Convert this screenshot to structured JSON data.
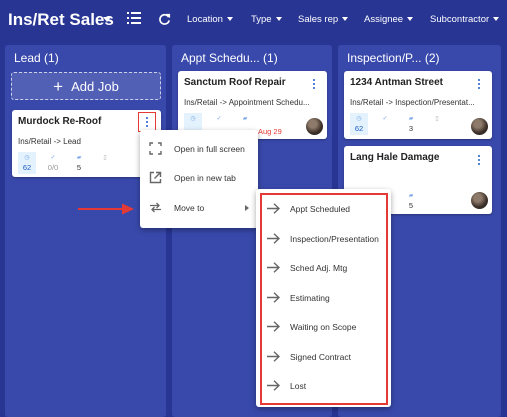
{
  "app": {
    "title": "Ins/Ret Sales"
  },
  "toolbar": {
    "filters": [
      {
        "label": "Location"
      },
      {
        "label": "Type"
      },
      {
        "label": "Sales rep"
      },
      {
        "label": "Assignee"
      },
      {
        "label": "Subcontractor"
      }
    ]
  },
  "columns": [
    {
      "title": "Lead (1)",
      "add_job_label": "Add Job"
    },
    {
      "title": "Appt Schedu... (1)"
    },
    {
      "title": "Inspection/P... (2)"
    }
  ],
  "cards": [
    {
      "title": "Murdock Re-Roof",
      "subtitle": "Ins/Retail -> Lead",
      "stats": [
        "62",
        "0/0",
        "5",
        ""
      ]
    },
    {
      "title": "Sanctum Roof Repair",
      "subtitle": "Ins/Retail -> Appointment Schedu...",
      "date": "Aug 29"
    },
    {
      "title": "1234 Antman Street",
      "subtitle": "Ins/Retail -> Inspection/Presentat...",
      "stats": [
        "62",
        "",
        "3",
        ""
      ]
    },
    {
      "title": "Lang Hale Damage",
      "stats": [
        "5"
      ]
    }
  ],
  "context_menu": {
    "items": [
      {
        "label": "Open in full screen",
        "icon": "fullscreen-icon"
      },
      {
        "label": "Open in new tab",
        "icon": "open-in-new-icon"
      },
      {
        "label": "Move to",
        "icon": "move-icon"
      }
    ]
  },
  "move_to_submenu": {
    "items": [
      {
        "label": "Appt Scheduled"
      },
      {
        "label": "Inspection/Presentation"
      },
      {
        "label": "Sched Adj. Mtg"
      },
      {
        "label": "Estimating"
      },
      {
        "label": "Waiting on Scope"
      },
      {
        "label": "Signed Contract"
      },
      {
        "label": "Lost"
      }
    ]
  },
  "colors": {
    "background": "#283593",
    "column": "#3949ab",
    "accent_blue": "#1e5bc6",
    "highlight_red": "#e53935"
  }
}
